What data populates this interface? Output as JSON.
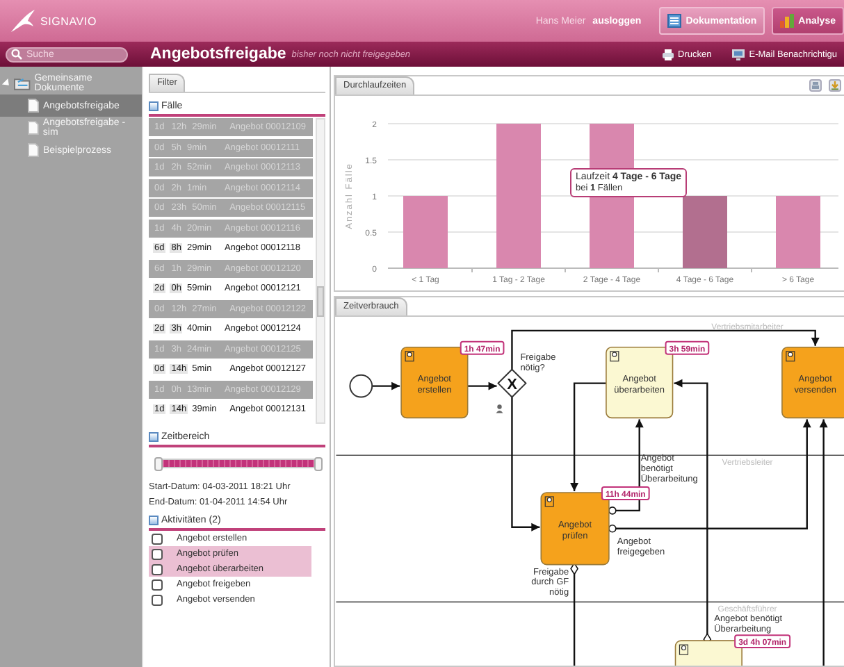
{
  "header": {
    "logo": "SIGNAVIO",
    "user": "Hans Meier",
    "logout": "ausloggen",
    "modes": [
      {
        "label": "Dokumentation",
        "selected": false
      },
      {
        "label": "Analyse",
        "selected": true
      }
    ]
  },
  "toolbar": {
    "search_placeholder": "Suche",
    "title": "Angebotsfreigabe",
    "subtitle": "bisher noch nicht freigegeben",
    "actions": [
      {
        "kind": "print",
        "label": "Drucken"
      },
      {
        "kind": "mail",
        "label": "E-Mail Benachrichtigu"
      }
    ]
  },
  "sidebar": {
    "tree": [
      {
        "label": "Gemeinsame Dokumente",
        "expanded": true,
        "selected": false,
        "children": [
          {
            "label": "Angebotsfreigabe",
            "selected": true
          },
          {
            "label": "Angebotsfreigabe - sim",
            "selected": false
          },
          {
            "label": "Beispielprozess",
            "selected": false
          }
        ]
      }
    ]
  },
  "filter": {
    "tab": "Filter",
    "cases": {
      "title": "Fälle",
      "expanded": true,
      "rows": [
        {
          "days": "1d",
          "hours": "12h",
          "minutes": "29min",
          "name": "Angebot 00012109",
          "selected": false
        },
        {
          "days": "0d",
          "hours": "5h",
          "minutes": "9min",
          "name": "Angebot 00012111",
          "selected": false
        },
        {
          "days": "1d",
          "hours": "2h",
          "minutes": "52min",
          "name": "Angebot 00012113",
          "selected": false
        },
        {
          "days": "0d",
          "hours": "2h",
          "minutes": "1min",
          "name": "Angebot 00012114",
          "selected": false
        },
        {
          "days": "0d",
          "hours": "23h",
          "minutes": "50min",
          "name": "Angebot 00012115",
          "selected": false
        },
        {
          "days": "1d",
          "hours": "4h",
          "minutes": "20min",
          "name": "Angebot 00012116",
          "selected": false
        },
        {
          "days": "6d",
          "hours": "8h",
          "minutes": "29min",
          "name": "Angebot 00012118",
          "selected": true
        },
        {
          "days": "6d",
          "hours": "1h",
          "minutes": "29min",
          "name": "Angebot 00012120",
          "selected": false
        },
        {
          "days": "2d",
          "hours": "0h",
          "minutes": "59min",
          "name": "Angebot 00012121",
          "selected": true
        },
        {
          "days": "0d",
          "hours": "12h",
          "minutes": "27min",
          "name": "Angebot 00012122",
          "selected": false
        },
        {
          "days": "2d",
          "hours": "3h",
          "minutes": "40min",
          "name": "Angebot 00012124",
          "selected": true
        },
        {
          "days": "1d",
          "hours": "3h",
          "minutes": "24min",
          "name": "Angebot 00012125",
          "selected": false
        },
        {
          "days": "0d",
          "hours": "14h",
          "minutes": "5min",
          "name": "Angebot 00012127",
          "selected": true
        },
        {
          "days": "1d",
          "hours": "0h",
          "minutes": "13min",
          "name": "Angebot 00012129",
          "selected": false
        },
        {
          "days": "1d",
          "hours": "14h",
          "minutes": "39min",
          "name": "Angebot 00012131",
          "selected": true
        }
      ]
    },
    "time_range": {
      "title": "Zeitbereich",
      "expanded": true,
      "level": 1,
      "start": "Start-Datum: 04-03-2011 18:21 Uhr",
      "end": "End-Datum: 01-04-2011 14:54 Uhr"
    },
    "activities": {
      "title": "Aktivitäten (2)",
      "expanded": true,
      "items": [
        {
          "label": "Angebot erstellen",
          "checked": false,
          "selected": false
        },
        {
          "label": "Angebot prüfen",
          "checked": false,
          "selected": true
        },
        {
          "label": "Angebot überarbeiten",
          "checked": false,
          "selected": true
        },
        {
          "label": "Angebot freigeben",
          "checked": false,
          "selected": false
        },
        {
          "label": "Angebot versenden",
          "checked": false,
          "selected": false
        }
      ]
    }
  },
  "throughput": {
    "tab": "Durchlaufzeiten",
    "chart_data": {
      "type": "bar",
      "ylabel": "Anzahl Fälle",
      "categories": [
        "< 1 Tag",
        "1 Tag - 2 Tage",
        "2 Tage - 4 Tage",
        "4 Tage - 6 Tage",
        "> 6 Tage"
      ],
      "series": [
        {
          "color": "#d987ae",
          "values": [
            1,
            2,
            2,
            1,
            1
          ]
        }
      ],
      "grid": true,
      "ylim": [
        0,
        2
      ],
      "yticks": [
        0,
        0.5,
        1,
        1.5,
        2
      ]
    },
    "bars": [
      {
        "selected": false
      },
      {
        "selected": false
      },
      {
        "selected": false
      },
      {
        "selected": true
      },
      {
        "selected": false
      }
    ],
    "tooltip": {
      "title": "Laufzeit **4 Tage - 6 Tage**",
      "detail": "bei **1** Fällen"
    }
  },
  "time_usage": {
    "tab": "Zeitverbrauch",
    "lanes": [
      "Vertriebsmitarbeiter",
      "Vertriebsleiter",
      "Geschäftsführer"
    ],
    "nodes": [
      {
        "kind": "start"
      },
      {
        "kind": "task",
        "label": "Angebot erstellen",
        "badge": "1h 47min",
        "color": "#f5a21c"
      },
      {
        "kind": "gateway",
        "symbol": "X"
      },
      {
        "kind": "task",
        "label": "Angebot überarbeiten",
        "badge": "3h 59min",
        "color": "#fbf8d2"
      },
      {
        "kind": "task",
        "label": "Angebot versenden",
        "color": "#f5a21c"
      },
      {
        "kind": "task",
        "label": "Angebot prüfen",
        "badge": "11h 44min",
        "color": "#f5a21c"
      },
      {
        "kind": "task",
        "badge": "3d 4h 07min",
        "color": "#fbf8d2"
      }
    ],
    "edge_labels": [
      {
        "lines": [
          "Freigabe",
          "nötig?"
        ]
      },
      {
        "lines": [
          "Angebot",
          "benötigt",
          "Überarbeitung"
        ]
      },
      {
        "lines": [
          "Angebot",
          "freigegeben"
        ]
      },
      {
        "lines": [
          "Freigabe",
          "durch GF",
          "nötig"
        ]
      },
      {
        "lines": [
          "Angebot benötigt",
          "Überarbeitung"
        ]
      }
    ]
  }
}
